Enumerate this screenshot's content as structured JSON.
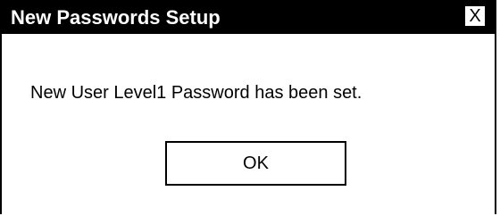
{
  "dialog": {
    "title": "New Passwords Setup",
    "close_label": "X",
    "message": "New User Level1 Password has been set.",
    "ok_label": "OK"
  }
}
